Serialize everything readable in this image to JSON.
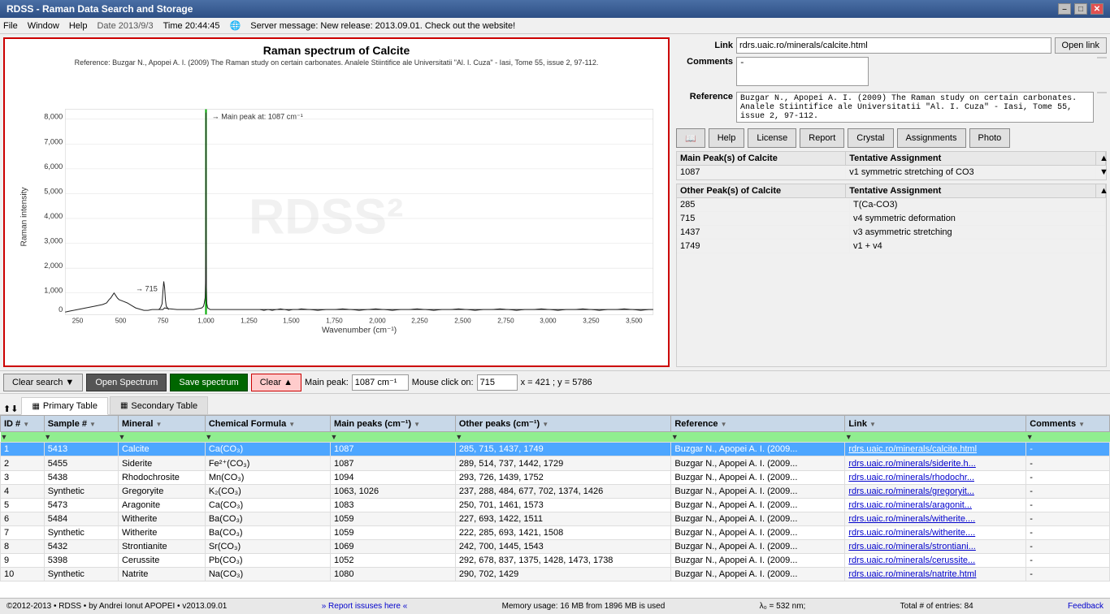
{
  "titlebar": {
    "title": "RDSS - Raman Data Search and Storage",
    "min": "–",
    "max": "□",
    "close": "✕"
  },
  "menubar": {
    "file": "File",
    "window": "Window",
    "help": "Help",
    "date": "Date 2013/9/3",
    "time": "Time 20:44:45",
    "server_message": "Server message: New release: 2013.09.01. Check out the website!"
  },
  "spectrum": {
    "title": "Raman spectrum of Calcite",
    "reference": "Reference: Buzgar N., Apopei A. I. (2009) The Raman study on certain carbonates. Analele Stiintifice ale Universitatii \"Al. I. Cuza\" - Iasi, Tome 55, issue 2, 97-112.",
    "main_peak_label": "→ Main peak at: 1087 cm⁻¹",
    "secondary_peak_label": "→ 715"
  },
  "right_panel": {
    "link_label": "Link",
    "link_value": "rdrs.uaic.ro/minerals/calcite.html",
    "open_link_btn": "Open link",
    "comments_label": "Comments",
    "comments_value": "-",
    "reference_label": "Reference",
    "reference_value": "Buzgar N., Apopei A. I. (2009) The Raman study on certain carbonates. Analele Stiintifice ale Universitatii \"Al. I. Cuza\" - Iasi, Tome 55, issue 2, 97-112.",
    "buttons": {
      "book": "📖",
      "help": "Help",
      "license": "License",
      "report": "Report",
      "crystal": "Crystal",
      "assignments": "Assignments",
      "photo": "Photo"
    },
    "main_peaks_label": "Main Peak(s) of Calcite",
    "tentative_label1": "Tentative Assignment",
    "main_peak_value": "1087",
    "main_peak_assignment": "v1 symmetric stretching of CO3",
    "other_peaks_label": "Other Peak(s) of Calcite",
    "tentative_label2": "Tentative Assignment",
    "other_peaks": [
      {
        "peak": "285",
        "assignment": "T(Ca-CO3)"
      },
      {
        "peak": "715",
        "assignment": "v4 symmetric deformation"
      },
      {
        "peak": "1437",
        "assignment": "v3 asymmetric stretching"
      },
      {
        "peak": "1749",
        "assignment": "v1 + v4"
      }
    ]
  },
  "toolbar": {
    "clear_search": "Clear search",
    "open_spectrum": "Open Spectrum",
    "save_spectrum": "Save spectrum",
    "clear": "Clear",
    "main_peak_label": "Main peak:",
    "main_peak_value": "1087 cm⁻¹",
    "mouse_click_label": "Mouse click on:",
    "mouse_click_value": "715",
    "coords": "x = 421 ; y = 5786"
  },
  "tabs": {
    "primary": "Primary Table",
    "secondary": "Secondary Table"
  },
  "table": {
    "columns": [
      "ID #",
      "Sample #",
      "Mineral",
      "Chemical Formula",
      "Main peaks (cm⁻¹)",
      "Other peaks (cm⁻¹)",
      "Reference",
      "Link",
      "Comments"
    ],
    "rows": [
      {
        "id": "1",
        "sample": "5413",
        "mineral": "Calcite",
        "formula": "Ca(CO₃)",
        "main_peaks": "1087",
        "other_peaks": "285, 715, 1437, 1749",
        "reference": "Buzgar N., Apopei A. I. (2009...",
        "link": "rdrs.uaic.ro/minerals/calcite.html",
        "comments": "-",
        "selected": true
      },
      {
        "id": "2",
        "sample": "5455",
        "mineral": "Siderite",
        "formula": "Fe²⁺(CO₃)",
        "main_peaks": "1087",
        "other_peaks": "289, 514, 737, 1442, 1729",
        "reference": "Buzgar N., Apopei A. I. (2009...",
        "link": "rdrs.uaic.ro/minerals/siderite.h...",
        "comments": "-",
        "selected": false
      },
      {
        "id": "3",
        "sample": "5438",
        "mineral": "Rhodochrosite",
        "formula": "Mn(CO₃)",
        "main_peaks": "1094",
        "other_peaks": "293, 726, 1439, 1752",
        "reference": "Buzgar N., Apopei A. I. (2009...",
        "link": "rdrs.uaic.ro/minerals/rhodochr...",
        "comments": "-",
        "selected": false
      },
      {
        "id": "4",
        "sample": "Synthetic",
        "mineral": "Gregoryite",
        "formula": "K₂(CO₃)",
        "main_peaks": "1063, 1026",
        "other_peaks": "237, 288, 484, 677, 702, 1374, 1426",
        "reference": "Buzgar N., Apopei A. I. (2009...",
        "link": "rdrs.uaic.ro/minerals/gregoryit...",
        "comments": "-",
        "selected": false
      },
      {
        "id": "5",
        "sample": "5473",
        "mineral": "Aragonite",
        "formula": "Ca(CO₃)",
        "main_peaks": "1083",
        "other_peaks": "250, 701, 1461, 1573",
        "reference": "Buzgar N., Apopei A. I. (2009...",
        "link": "rdrs.uaic.ro/minerals/aragonit...",
        "comments": "-",
        "selected": false
      },
      {
        "id": "6",
        "sample": "5484",
        "mineral": "Witherite",
        "formula": "Ba(CO₃)",
        "main_peaks": "1059",
        "other_peaks": "227, 693, 1422, 1511",
        "reference": "Buzgar N., Apopei A. I. (2009...",
        "link": "rdrs.uaic.ro/minerals/witherite....",
        "comments": "-",
        "selected": false
      },
      {
        "id": "7",
        "sample": "Synthetic",
        "mineral": "Witherite",
        "formula": "Ba(CO₃)",
        "main_peaks": "1059",
        "other_peaks": "222, 285, 693, 1421, 1508",
        "reference": "Buzgar N., Apopei A. I. (2009...",
        "link": "rdrs.uaic.ro/minerals/witherite....",
        "comments": "-",
        "selected": false
      },
      {
        "id": "8",
        "sample": "5432",
        "mineral": "Strontianite",
        "formula": "Sr(CO₃)",
        "main_peaks": "1069",
        "other_peaks": "242, 700, 1445, 1543",
        "reference": "Buzgar N., Apopei A. I. (2009...",
        "link": "rdrs.uaic.ro/minerals/strontiani...",
        "comments": "-",
        "selected": false
      },
      {
        "id": "9",
        "sample": "5398",
        "mineral": "Cerussite",
        "formula": "Pb(CO₃)",
        "main_peaks": "1052",
        "other_peaks": "292, 678, 837, 1375, 1428, 1473, 1738",
        "reference": "Buzgar N., Apopei A. I. (2009...",
        "link": "rdrs.uaic.ro/minerals/cerussite...",
        "comments": "-",
        "selected": false
      },
      {
        "id": "10",
        "sample": "Synthetic",
        "mineral": "Natrite",
        "formula": "Na(CO₃)",
        "main_peaks": "1080",
        "other_peaks": "290, 702, 1429",
        "reference": "Buzgar N., Apopei A. I. (2009...",
        "link": "rdrs.uaic.ro/minerals/natrite.html",
        "comments": "-",
        "selected": false
      }
    ]
  },
  "status_bar": {
    "copyright": "©2012-2013 • RDSS • by Andrei Ionut APOPEI • v2013.09.01",
    "report_issues": "» Report issuses here «",
    "memory": "Memory usage: 16 MB from 1896 MB is used",
    "lambda": "λ₀ = 532 nm;",
    "total_entries": "Total # of entries: 84",
    "feedback": "Feedback"
  },
  "chart": {
    "y_axis_label": "Raman intensity",
    "x_axis_label": "Wavenumber (cm⁻¹)",
    "y_ticks": [
      "8,000",
      "7,000",
      "6,000",
      "5,000",
      "4,000",
      "3,000",
      "2,000",
      "1,000",
      "0"
    ],
    "x_ticks": [
      "250",
      "500",
      "750",
      "1,000",
      "1,250",
      "1,500",
      "1,750",
      "2,000",
      "2,250",
      "2,500",
      "2,750",
      "3,000",
      "3,250",
      "3,500"
    ]
  }
}
